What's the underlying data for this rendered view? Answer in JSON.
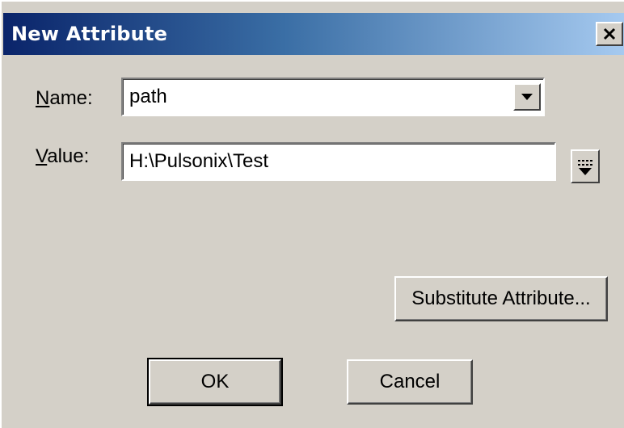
{
  "window": {
    "title": "New Attribute"
  },
  "form": {
    "name_label_accel": "N",
    "name_label_rest": "ame:",
    "name_value": "path",
    "value_label_accel": "V",
    "value_label_rest": "alue:",
    "value_value": "H:\\Pulsonix\\Test"
  },
  "buttons": {
    "substitute": "Substitute Attribute...",
    "ok": "OK",
    "cancel": "Cancel"
  },
  "icons": {
    "close": "close-icon",
    "combo_arrow": "chevron-down-icon",
    "value_menu": "menu-dropdown-icon"
  }
}
